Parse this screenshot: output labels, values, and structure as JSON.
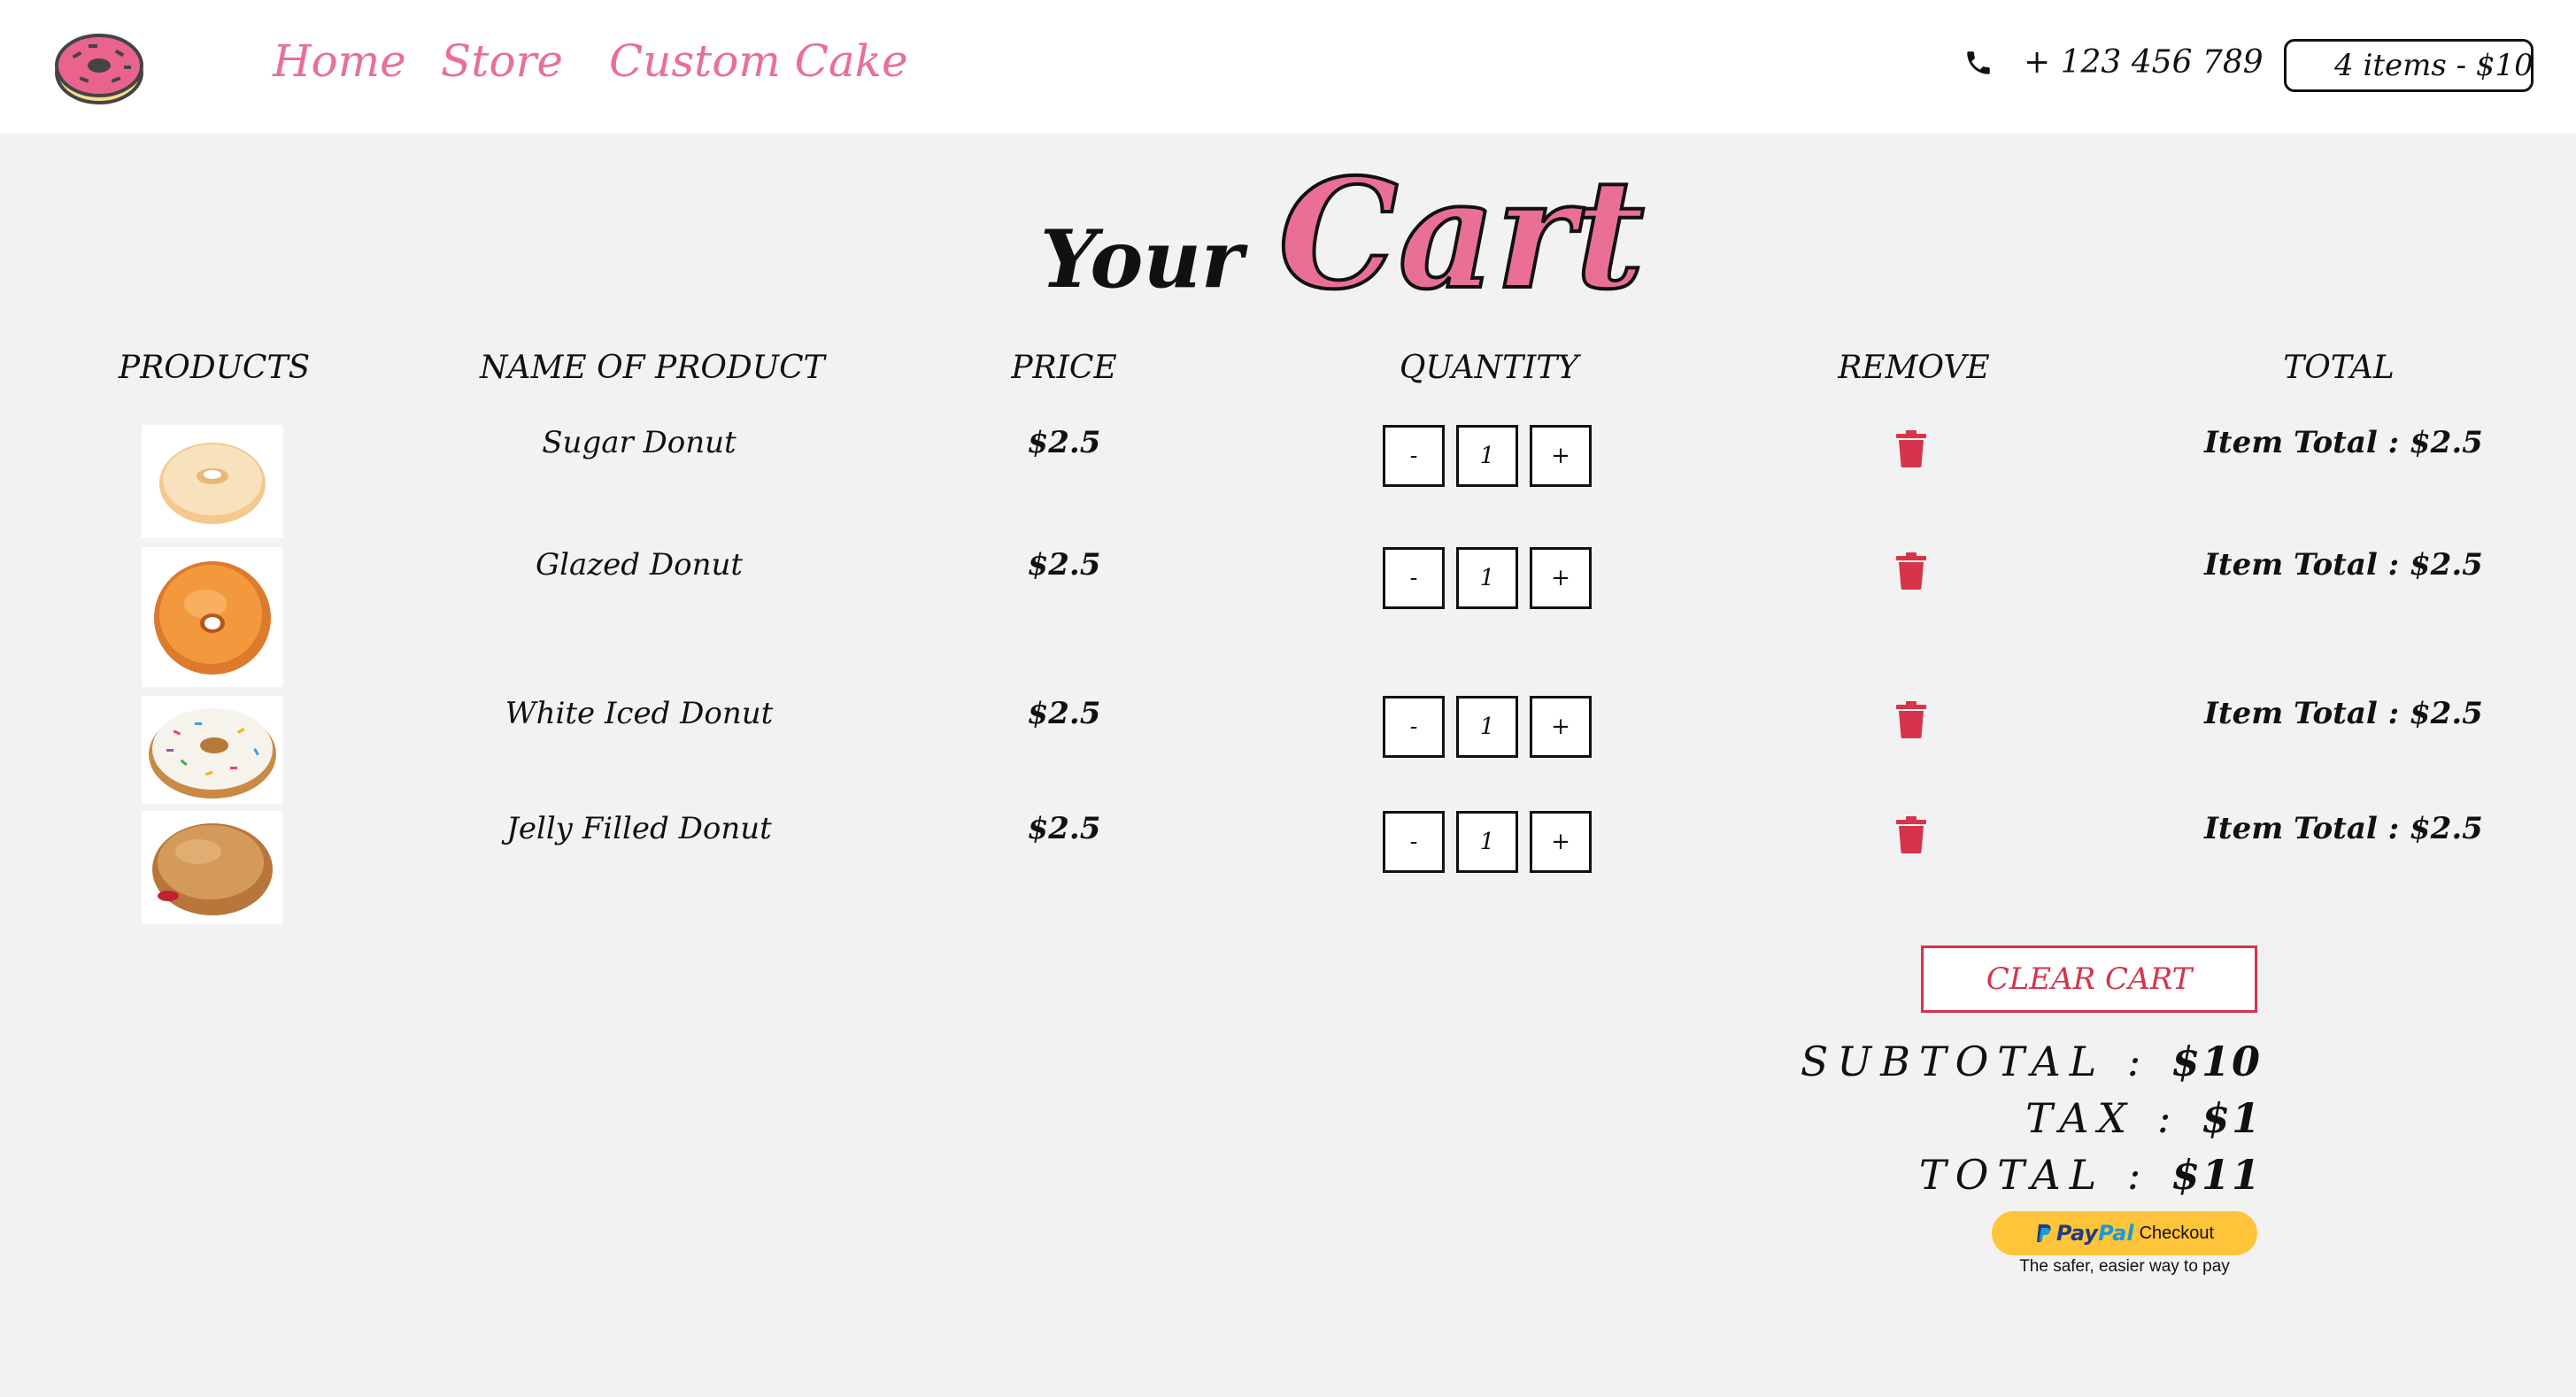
{
  "nav": {
    "links": [
      "Home",
      "Store",
      "Custom Cake"
    ],
    "phone": "+ 123 456 789",
    "cart_summary": "4 items - $10"
  },
  "title": {
    "your": "Your",
    "cart": "Cart"
  },
  "table": {
    "headers": [
      "PRODUCTS",
      "NAME OF PRODUCT",
      "PRICE",
      "QUANTITY",
      "REMOVE",
      "TOTAL"
    ],
    "rows": [
      {
        "name": "Sugar Donut",
        "price": "$2.5",
        "qty": "1",
        "minus": "-",
        "plus": "+",
        "item_total": "Item Total : $2.5"
      },
      {
        "name": "Glazed Donut",
        "price": "$2.5",
        "qty": "1",
        "minus": "-",
        "plus": "+",
        "item_total": "Item Total : $2.5"
      },
      {
        "name": "White Iced Donut",
        "price": "$2.5",
        "qty": "1",
        "minus": "-",
        "plus": "+",
        "item_total": "Item Total : $2.5"
      },
      {
        "name": "Jelly Filled Donut",
        "price": "$2.5",
        "qty": "1",
        "minus": "-",
        "plus": "+",
        "item_total": "Item Total : $2.5"
      }
    ]
  },
  "summary": {
    "clear_label": "CLEAR CART",
    "subtotal_label": "SUBTOTAL : ",
    "subtotal_value": "$10",
    "tax_label": "TAX : ",
    "tax_value": "$1",
    "total_label": "TOTAL : ",
    "total_value": "$11"
  },
  "paypal": {
    "brand_a": "Pay",
    "brand_b": "Pal",
    "checkout": "Checkout",
    "tagline": "The safer, easier way to pay"
  },
  "colors": {
    "accent": "#ea6f95",
    "danger": "#d6344b",
    "paypal": "#ffc439"
  }
}
